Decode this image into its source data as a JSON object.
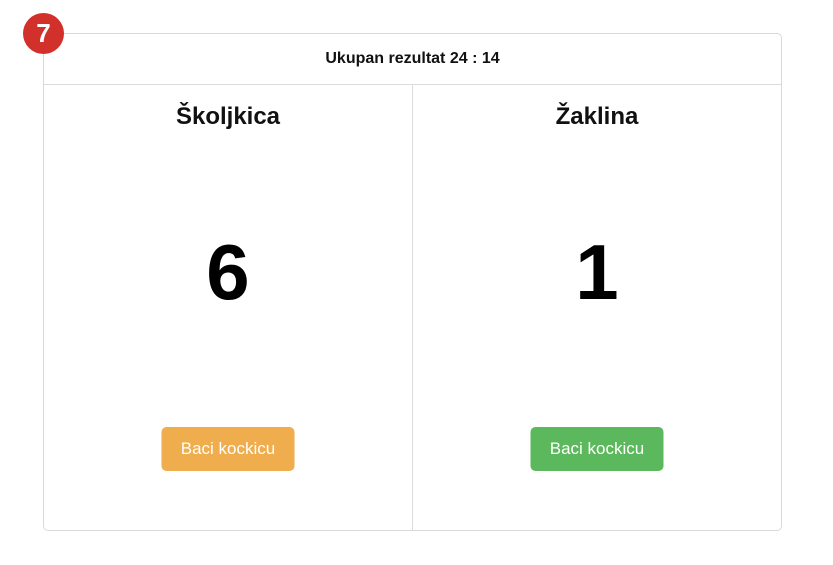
{
  "step_badge": "7",
  "header": {
    "total_score_text": "Ukupan rezultat 24 : 14"
  },
  "players": [
    {
      "name": "Školjkica",
      "die_value": "6",
      "button_label": "Baci kockicu",
      "button_color": "#efad4d"
    },
    {
      "name": "Žaklina",
      "die_value": "1",
      "button_label": "Baci kockicu",
      "button_color": "#5cb85c"
    }
  ],
  "colors": {
    "badge": "#d2302b",
    "border": "#d9d9d9"
  }
}
